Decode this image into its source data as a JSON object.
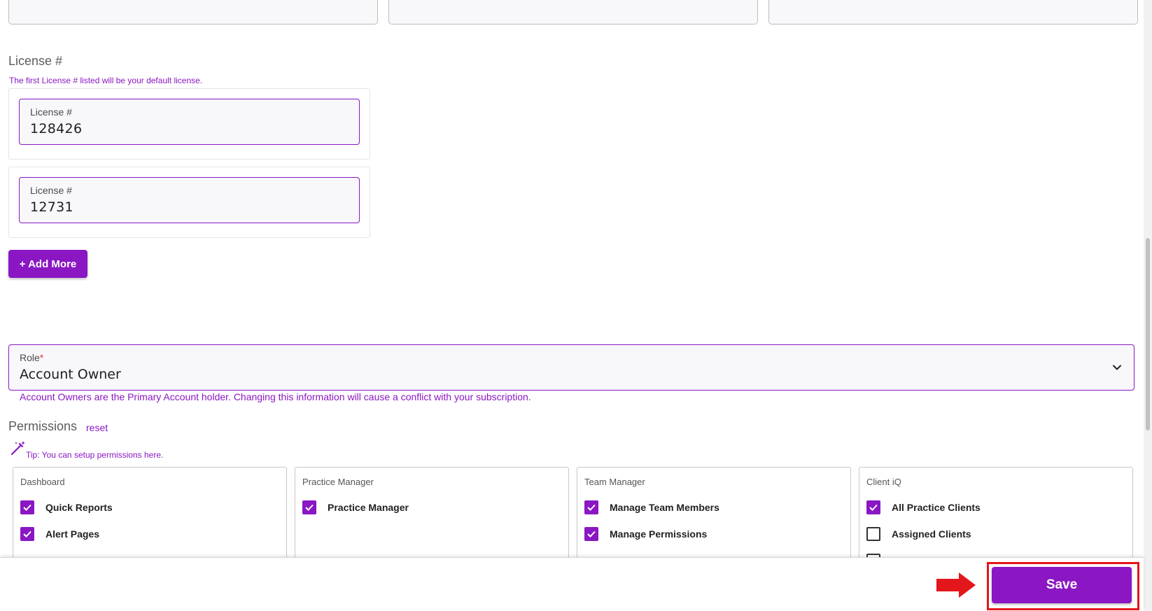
{
  "license": {
    "title": "License #",
    "hint": "The first License # listed will be your default license.",
    "entries": [
      {
        "label": "License #",
        "value": "128426"
      },
      {
        "label": "License #",
        "value": "12731"
      }
    ],
    "add_more_label": "+ Add More"
  },
  "role": {
    "label": "Role",
    "required_mark": "*",
    "value": "Account Owner",
    "note": "Account Owners are the Primary Account holder. Changing this information will cause a conflict with your subscription."
  },
  "permissions": {
    "title": "Permissions",
    "reset_label": "reset",
    "tip": "Tip: You can setup permissions here.",
    "groups": [
      {
        "category": "Dashboard",
        "items": [
          {
            "label": "Quick Reports",
            "checked": true
          },
          {
            "label": "Alert Pages",
            "checked": true
          }
        ]
      },
      {
        "category": "Practice Manager",
        "items": [
          {
            "label": "Practice Manager",
            "checked": true
          }
        ]
      },
      {
        "category": "Team Manager",
        "items": [
          {
            "label": "Manage Team Members",
            "checked": true
          },
          {
            "label": "Manage Permissions",
            "checked": true
          }
        ]
      },
      {
        "category": "Client iQ",
        "items": [
          {
            "label": "All Practice Clients",
            "checked": true
          },
          {
            "label": "Assigned Clients",
            "checked": false
          }
        ]
      }
    ]
  },
  "footer": {
    "save_label": "Save"
  },
  "colors": {
    "accent": "#8a17c3",
    "highlight": "#e3161b"
  },
  "icons": {
    "chevron": "chevron-down-icon",
    "wand": "magic-wand-icon",
    "arrow": "arrow-right-icon",
    "check": "check-icon"
  }
}
